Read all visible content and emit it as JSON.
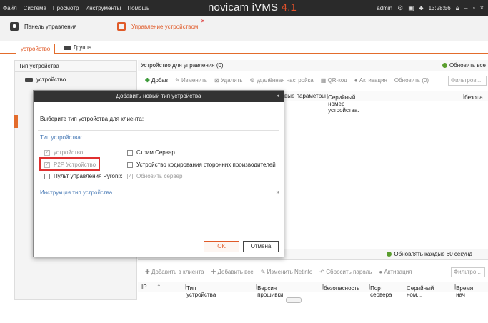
{
  "titlebar": {
    "menu": [
      "Файл",
      "Система",
      "Просмотр",
      "Инструменты",
      "Помощь"
    ],
    "brand_name": "novicam iVMS",
    "brand_version": "4.1",
    "user": "admin",
    "time": "13:28:56"
  },
  "tabs": {
    "control_panel": "Панель управления",
    "device_management": "Управление устройством"
  },
  "subtabs": {
    "device": "устройство",
    "group": "Группа"
  },
  "left": {
    "header": "Тип устройства",
    "items": [
      "устройство"
    ]
  },
  "right": {
    "header": "Устройство для управления (0)",
    "refresh_all": "Обновить все",
    "toolbar": {
      "add": "Добав",
      "edit": "Изменить",
      "delete": "Удалить",
      "remote_config": "удалённая настройка",
      "qr": "QR-код",
      "activation": "Активация",
      "refresh": "Обновить (0)",
      "filter_placeholder": "Фильтров..."
    },
    "columns": {
      "params": "вые параметры",
      "serial": "Серийный номер устройства.",
      "security": "безопа"
    },
    "online": {
      "refresh_every": "Обновлять каждые 60 секунд",
      "toolbar": {
        "add_to_client": "Добавить в клиента",
        "add_all": "Добавить все",
        "modify_netinfo": "Изменить Netinfo",
        "reset_password": "Сбросить пароль",
        "activation": "Активация",
        "filter_placeholder": "Фильтро..."
      },
      "columns": [
        "IP",
        "Тип устройства",
        "Версия прошивки",
        "безопасность",
        "Порт сервера",
        "Серийный ном...",
        "Время нач"
      ]
    }
  },
  "dialog": {
    "title": "Добавить новый тип устройства",
    "prompt": "Выберите тип устройства для клиента:",
    "types_label": "Тип устройства:",
    "options": {
      "device": "устройство",
      "stream_server": "Стрим Сервер",
      "p2p_device": "P2P Устройство",
      "third_party_encoder": "Устройство кодирования сторонних производителей",
      "pyronix": "Пульт управления Pyronix",
      "update_server": "Обновить сервер"
    },
    "instructions": "Инструкция тип устройства",
    "ok": "OK",
    "cancel": "Отмена"
  },
  "colors": {
    "accent": "#e36c2c",
    "highlight": "#e03030",
    "link_blue": "#4a7bb6"
  }
}
